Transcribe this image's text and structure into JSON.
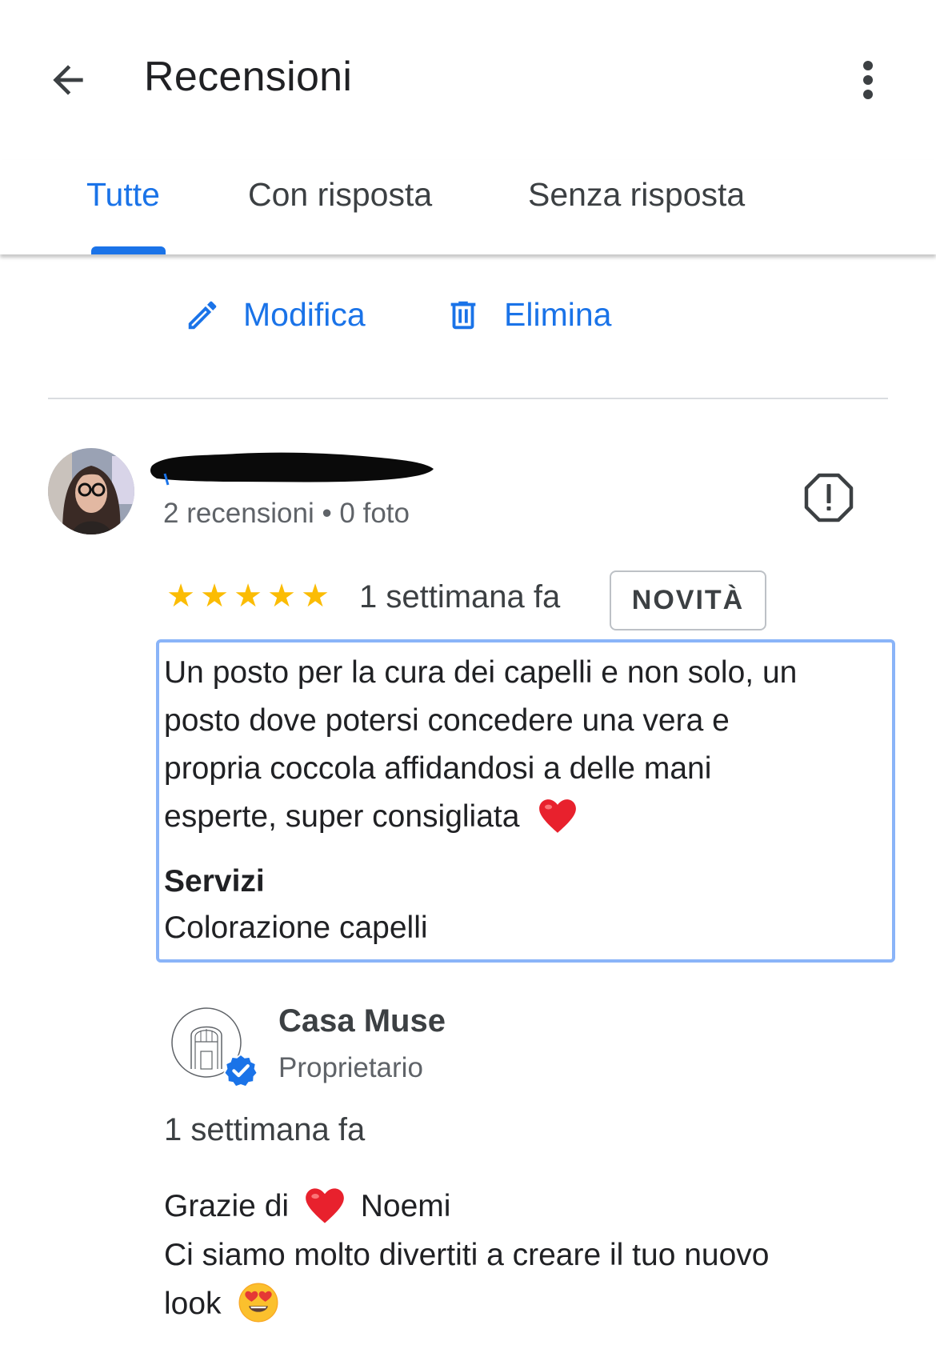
{
  "header": {
    "title": "Recensioni",
    "back_icon": "arrow-back-icon",
    "more_icon": "more-vert-icon"
  },
  "tabs": [
    {
      "label": "Tutte",
      "active": true
    },
    {
      "label": "Con risposta",
      "active": false
    },
    {
      "label": "Senza risposta",
      "active": false
    }
  ],
  "actions": {
    "edit_label": "Modifica",
    "delete_label": "Elimina"
  },
  "review": {
    "reviewer_meta": "2 recensioni • 0 foto",
    "rating": 5,
    "date": "1 settimana fa",
    "badge": "NOVITÀ",
    "text_lines": [
      "Un posto per la cura dei capelli e non solo, un",
      "posto dove potersi concedere una vera e",
      "propria coccola affidandosi a delle mani",
      "esperte, super consigliata"
    ],
    "services_title": "Servizi",
    "services_value": "Colorazione capelli"
  },
  "owner_reply": {
    "name": "Casa Muse",
    "role": "Proprietario",
    "date": "1 settimana fa",
    "line1_before": "Grazie di",
    "line1_after": "Noemi",
    "line2": "Ci siamo molto divertiti a creare il tuo nuovo",
    "line3": "look"
  },
  "colors": {
    "accent": "#1a73e8",
    "star": "#fbbc04",
    "heart": "#e8212d",
    "focus_border": "#8ab4f8"
  }
}
